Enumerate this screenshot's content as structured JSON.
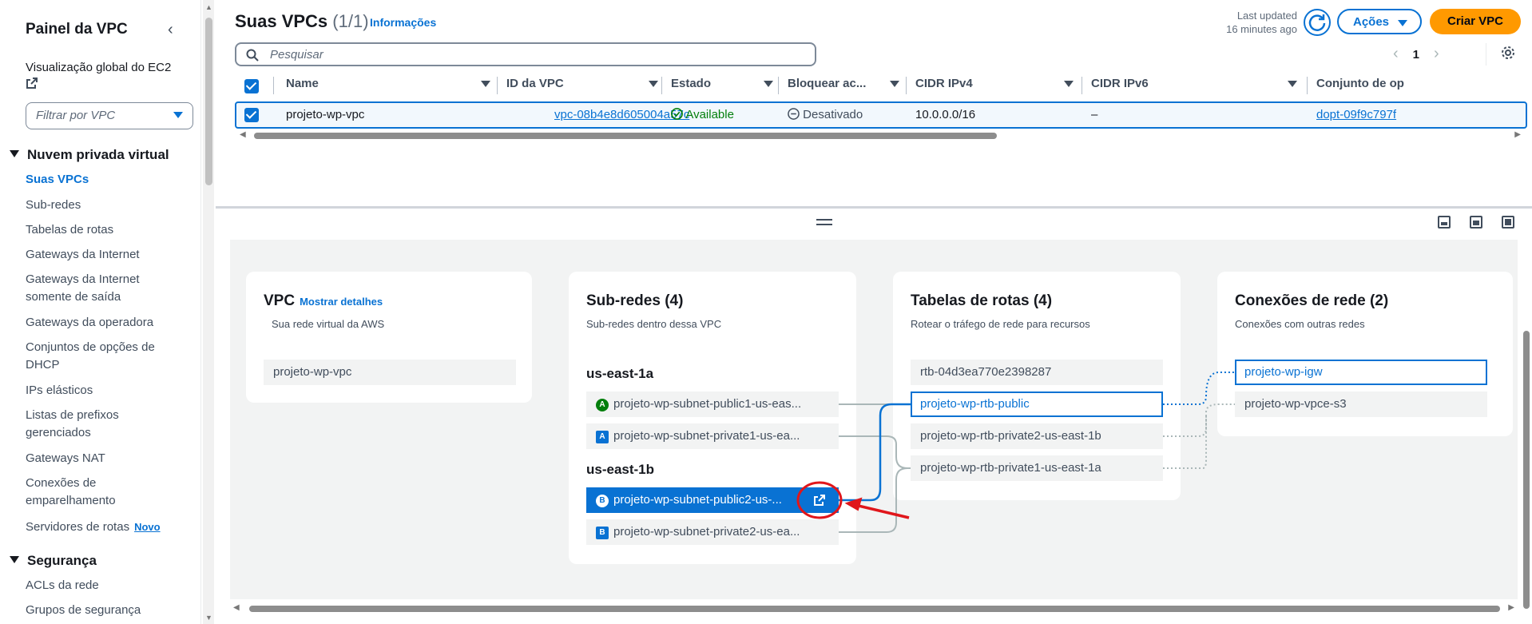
{
  "sidebar": {
    "title": "Painel da VPC",
    "ec2_global": "Visualização global do EC2",
    "filter_placeholder": "Filtrar por VPC",
    "sections": {
      "vpc": "Nuvem privada virtual",
      "security": "Segurança"
    },
    "items": [
      {
        "label": "Suas VPCs",
        "active": true
      },
      {
        "label": "Sub-redes"
      },
      {
        "label": "Tabelas de rotas"
      },
      {
        "label": "Gateways da Internet"
      },
      {
        "label": "Gateways da Internet somente de saída"
      },
      {
        "label": "Gateways da operadora"
      },
      {
        "label": "Conjuntos de opções de DHCP"
      },
      {
        "label": "IPs elásticos"
      },
      {
        "label": "Listas de prefixos gerenciados"
      },
      {
        "label": "Gateways NAT"
      },
      {
        "label": "Conexões de emparelhamento"
      },
      {
        "label": "Servidores de rotas",
        "badge": "Novo"
      }
    ],
    "security_items": [
      {
        "label": "ACLs da rede"
      },
      {
        "label": "Grupos de segurança"
      }
    ]
  },
  "header": {
    "title": "Suas VPCs",
    "count": "(1/1)",
    "info": "Informações",
    "last_updated_1": "Last updated",
    "last_updated_2": "16 minutes ago",
    "actions": "Ações",
    "create": "Criar VPC",
    "search_placeholder": "Pesquisar",
    "page": "1"
  },
  "table": {
    "columns": [
      "Name",
      "ID da VPC",
      "Estado",
      "Bloquear ac...",
      "CIDR IPv4",
      "CIDR IPv6",
      "Conjunto de op"
    ],
    "row": {
      "name": "projeto-wp-vpc",
      "vpc_id": "vpc-08b4e8d605004a57c",
      "state": "Available",
      "block": "Desativado",
      "cidr_v4": "10.0.0.0/16",
      "cidr_v6": "–",
      "dhcp": "dopt-09f9c797f"
    }
  },
  "resource_map": {
    "vpc_card": {
      "title": "VPC",
      "link": "Mostrar detalhes",
      "subtitle": "Sua rede virtual da AWS",
      "vpc": "projeto-wp-vpc"
    },
    "subnets_card": {
      "title": "Sub-redes (4)",
      "subtitle": "Sub-redes dentro dessa VPC",
      "zone_a": "us-east-1a",
      "zone_b": "us-east-1b",
      "az_a": "A",
      "az_b": "B",
      "subnets": [
        "projeto-wp-subnet-public1-us-eas...",
        "projeto-wp-subnet-private1-us-ea...",
        "projeto-wp-subnet-public2-us-...",
        "projeto-wp-subnet-private2-us-ea..."
      ]
    },
    "routes_card": {
      "title": "Tabelas de rotas (4)",
      "subtitle": "Rotear o tráfego de rede para recursos",
      "tables": [
        "rtb-04d3ea770e2398287",
        "projeto-wp-rtb-public",
        "projeto-wp-rtb-private2-us-east-1b",
        "projeto-wp-rtb-private1-us-east-1a"
      ]
    },
    "connections_card": {
      "title": "Conexões de rede (2)",
      "subtitle": "Conexões com outras redes",
      "connections": [
        "projeto-wp-igw",
        "projeto-wp-vpce-s3"
      ]
    }
  },
  "colors": {
    "accent": "#0972d3",
    "primary_button": "#ff9900",
    "success": "#037f0c",
    "annotation": "#e0161b"
  }
}
